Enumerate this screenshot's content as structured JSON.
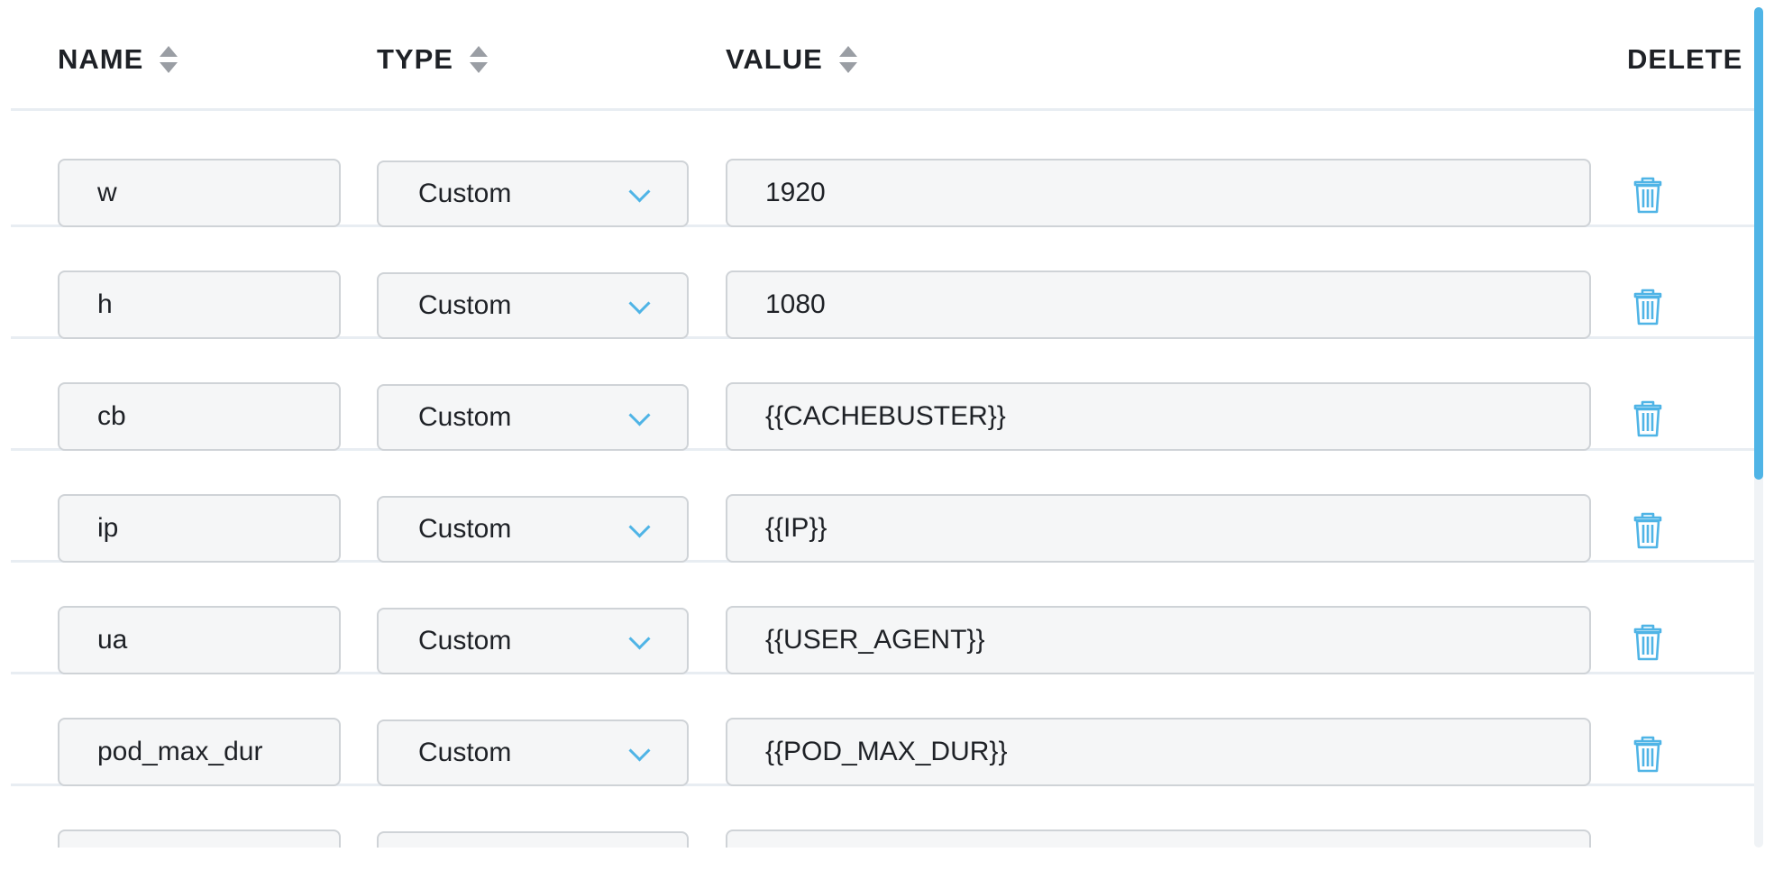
{
  "headers": {
    "name": "NAME",
    "type": "TYPE",
    "value": "VALUE",
    "delete": "DELETE"
  },
  "rows": [
    {
      "name": "w",
      "type": "Custom",
      "value": "1920"
    },
    {
      "name": "h",
      "type": "Custom",
      "value": "1080"
    },
    {
      "name": "cb",
      "type": "Custom",
      "value": "{{CACHEBUSTER}}"
    },
    {
      "name": "ip",
      "type": "Custom",
      "value": "{{IP}}"
    },
    {
      "name": "ua",
      "type": "Custom",
      "value": "{{USER_AGENT}}"
    },
    {
      "name": "pod_max_dur",
      "type": "Custom",
      "value": "{{POD_MAX_DUR}}"
    },
    {
      "name": "",
      "type": "",
      "value": ""
    }
  ],
  "icons": {
    "sort": "sort-icon",
    "dropdown": "chevron-down-icon",
    "delete": "trash-icon"
  },
  "colors": {
    "accent": "#4fb4e6",
    "border": "#cfd3d7",
    "field_bg": "#f5f6f7",
    "divider": "#e8edf2",
    "text": "#1e2126"
  }
}
